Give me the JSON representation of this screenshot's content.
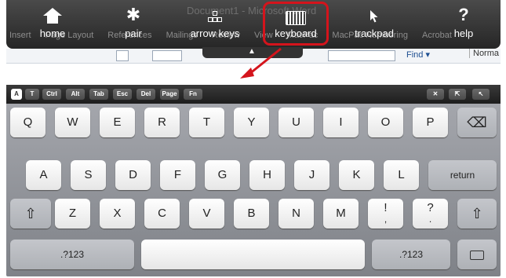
{
  "window": {
    "title": "Document1 - Microsoft Word"
  },
  "ribbon": {
    "tabs": [
      "Insert",
      "Page Layout",
      "References",
      "Mailings",
      "Review",
      "View",
      "MacPac",
      "MacPac Numbering",
      "Acrobat"
    ]
  },
  "toolbar": {
    "home": "home",
    "pair": "pair",
    "arrow_keys": "arrow keys",
    "keyboard": "keyboard",
    "trackpad": "trackpad",
    "help": "help",
    "help_glyph": "?",
    "bluetooth_glyph": "✱"
  },
  "substrip": {
    "find": "Find ▾",
    "style": "Norma"
  },
  "highlight": {
    "color": "#d4141c"
  },
  "modifiers": [
    "T",
    "Ctrl",
    "Alt",
    "Tab",
    "Esc",
    "Del",
    "Page",
    "Fn"
  ],
  "keyboard": {
    "row1": [
      "Q",
      "W",
      "E",
      "R",
      "T",
      "Y",
      "U",
      "I",
      "O",
      "P"
    ],
    "row2": [
      "A",
      "S",
      "D",
      "F",
      "G",
      "H",
      "J",
      "K",
      "L"
    ],
    "row3": [
      "Z",
      "X",
      "C",
      "V",
      "B",
      "N",
      "M"
    ],
    "row3_punct": {
      "a": "!",
      "a2": ",",
      "b": "?",
      "b2": "."
    },
    "return_label": "return",
    "numbers_label": ".?123",
    "backspace": "⌫",
    "shift": "⇧"
  }
}
